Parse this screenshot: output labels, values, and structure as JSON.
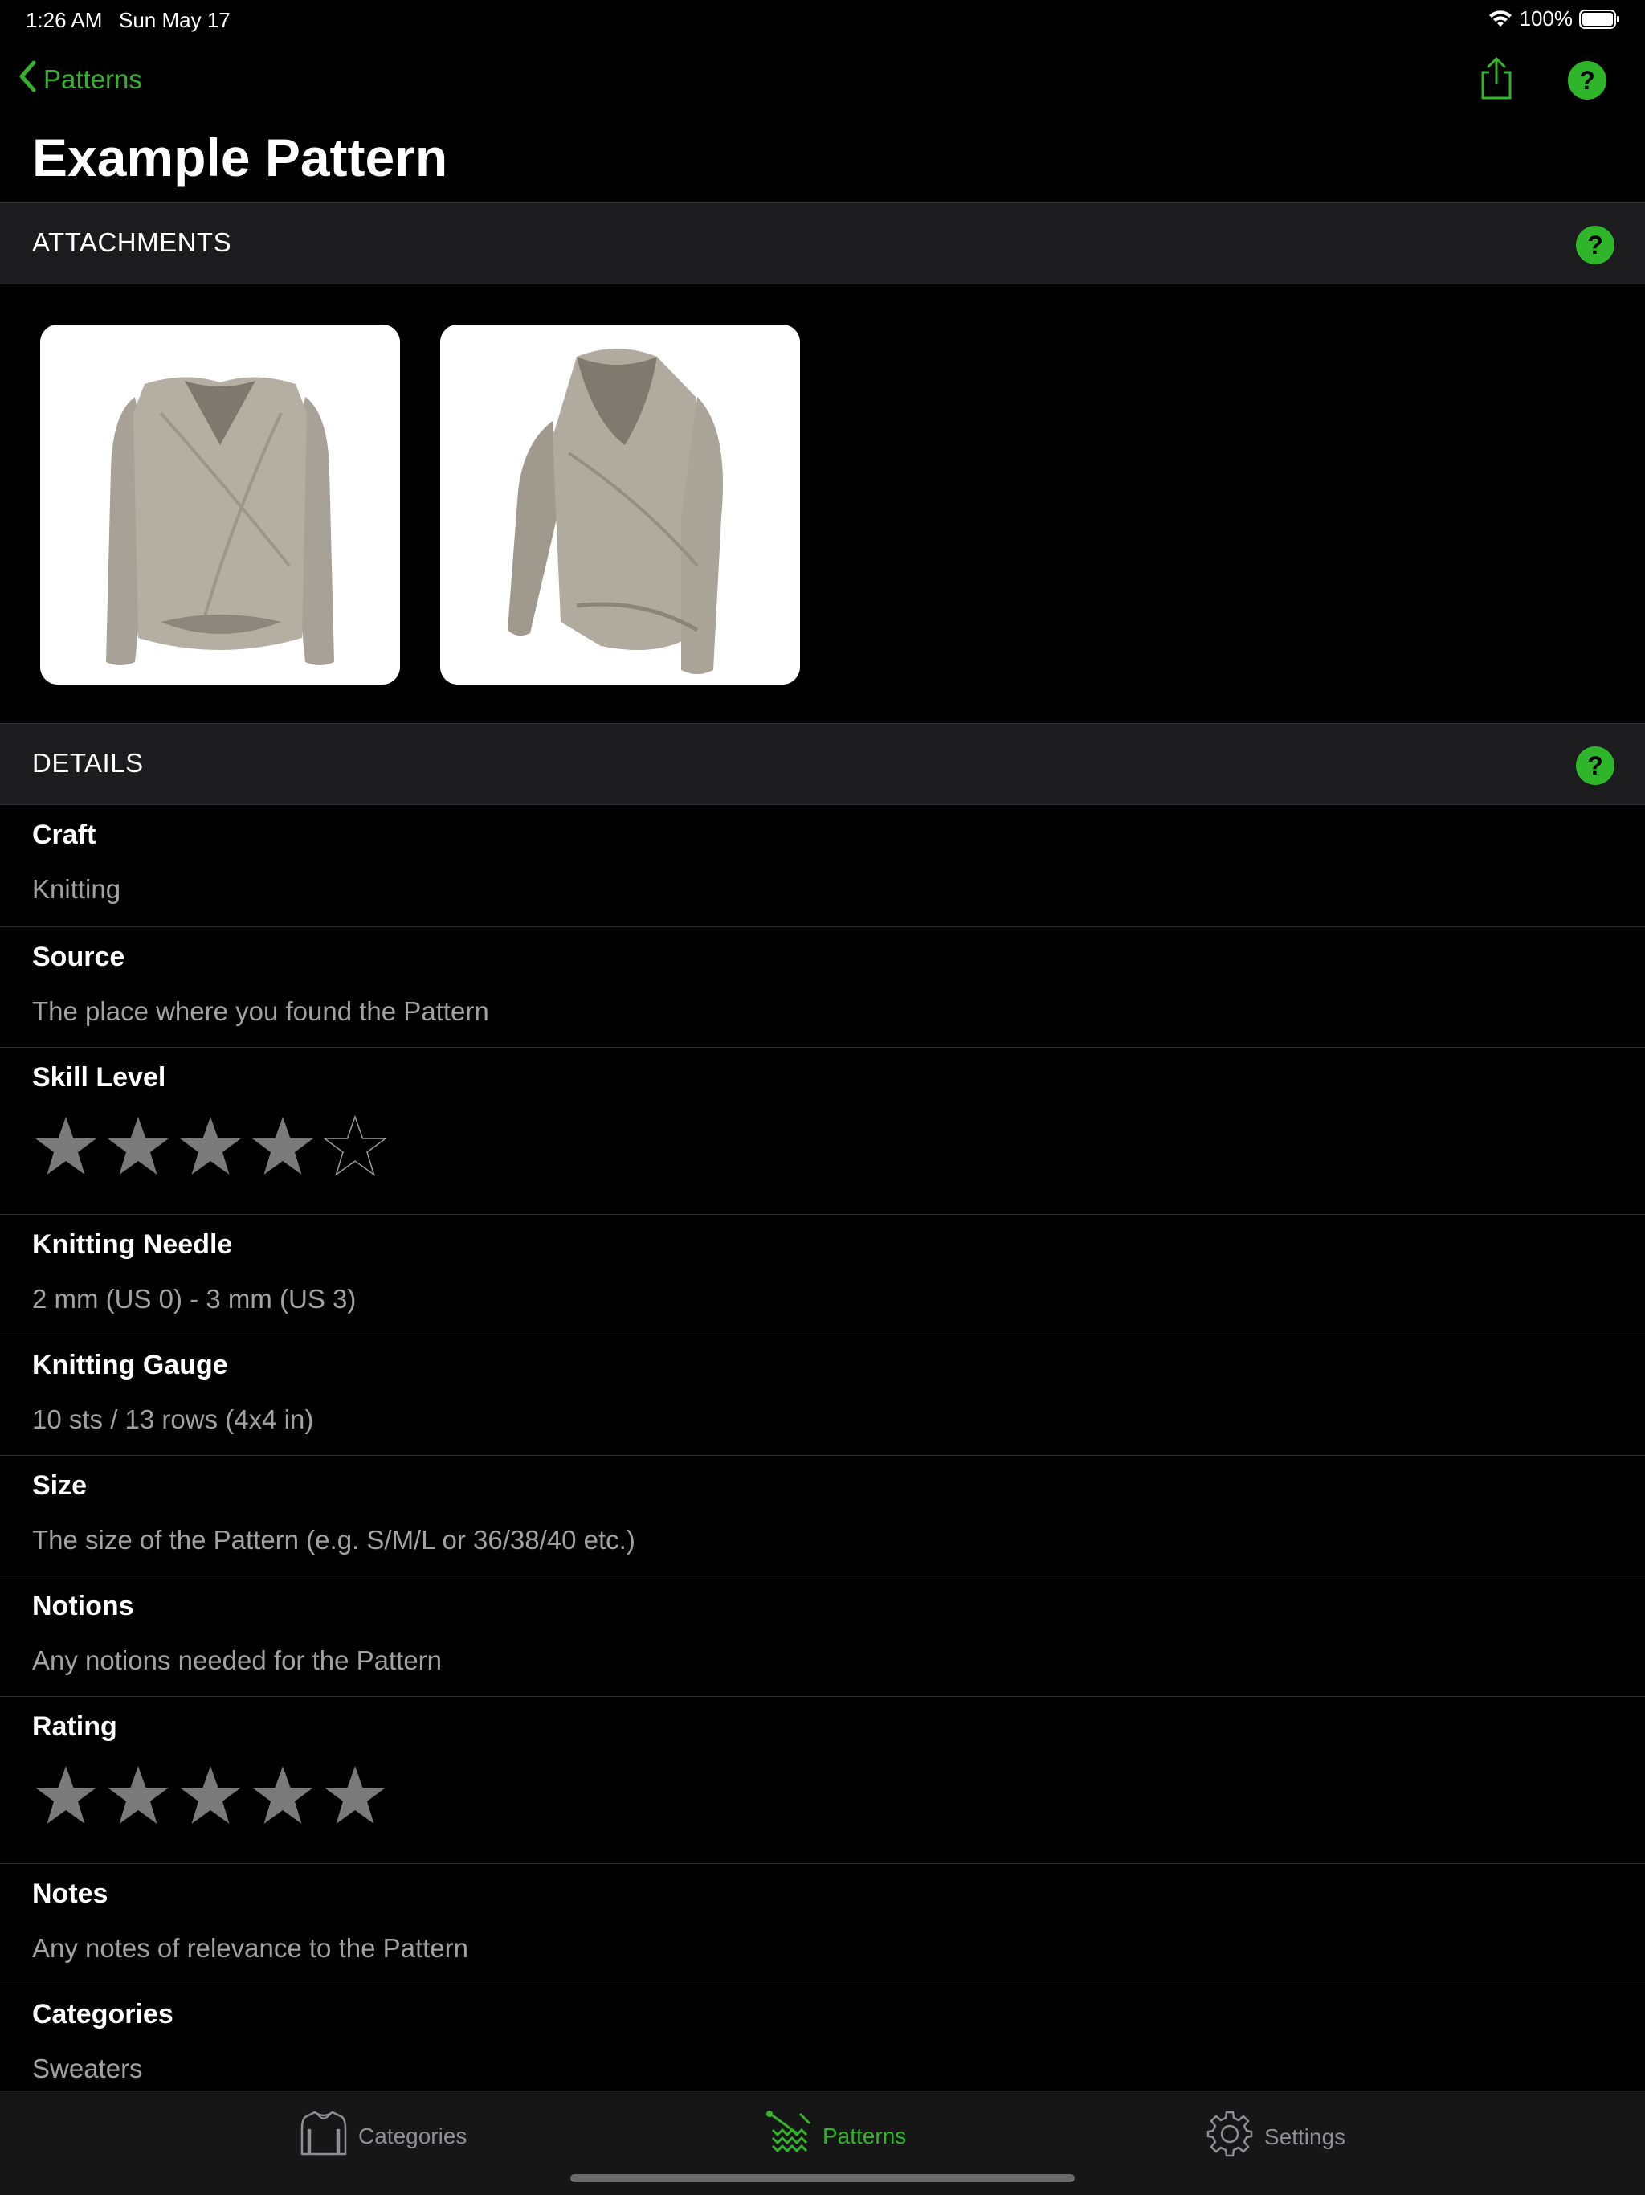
{
  "status_bar": {
    "time": "1:26 AM",
    "date": "Sun May 17",
    "battery": "100%"
  },
  "nav": {
    "back_label": "Patterns",
    "title": "Example Pattern",
    "icons": [
      "chevron-left-icon",
      "share-icon",
      "help-icon"
    ]
  },
  "attachments": {
    "header": "ATTACHMENTS",
    "items": [
      {
        "name": "sweater-front-photo"
      },
      {
        "name": "sweater-side-photo"
      }
    ]
  },
  "details": {
    "header": "DETAILS",
    "rows": [
      {
        "label": "Craft",
        "value": "Knitting"
      },
      {
        "label": "Source",
        "value": "The place where you found the Pattern"
      },
      {
        "label": "Skill Level",
        "stars": 4,
        "max": 5
      },
      {
        "label": "Knitting Needle",
        "value": "2 mm (US 0) - 3 mm (US 3)"
      },
      {
        "label": "Knitting Gauge",
        "value": "10 sts / 13 rows (4x4 in)"
      },
      {
        "label": "Size",
        "value": "The size of the Pattern (e.g. S/M/L or 36/38/40 etc.)"
      },
      {
        "label": "Notions",
        "value": "Any notions needed for the Pattern"
      },
      {
        "label": "Rating",
        "stars": 5,
        "max": 5
      },
      {
        "label": "Notes",
        "value": "Any notes of relevance to the Pattern"
      },
      {
        "label": "Categories",
        "value": "Sweaters"
      }
    ]
  },
  "tab_bar": {
    "tabs": [
      {
        "label": "Categories",
        "icon": "sweater-icon",
        "active": false
      },
      {
        "label": "Patterns",
        "icon": "knitting-pattern-icon",
        "active": true
      },
      {
        "label": "Settings",
        "icon": "gear-icon",
        "active": false
      }
    ]
  },
  "colors": {
    "accent": "#35b22c",
    "help_badge": "#2fb52a",
    "background": "#000000",
    "section_bg": "#1c1c1e",
    "secondary_text": "#a2a2a2",
    "star": "#7a7a7a"
  }
}
